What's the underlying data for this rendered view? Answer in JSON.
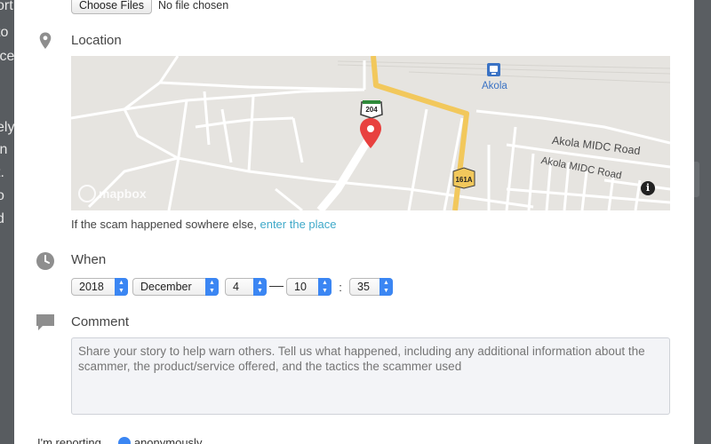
{
  "background": {
    "left_text_fragments": [
      "ort",
      "to",
      "ice",
      "ely",
      "in",
      "t.",
      "o",
      "d"
    ]
  },
  "file_upload": {
    "button_label": "Choose Files",
    "status": "No file chosen"
  },
  "location": {
    "title": "Location",
    "icon": "map-pin-icon",
    "map": {
      "labels": {
        "station": "Akola",
        "road1": "Akola MIDC Road",
        "road2": "Akola MIDC Road",
        "highway_204": "204",
        "highway_161a": "161A"
      },
      "attribution": "mapbox",
      "info_symbol": "i"
    },
    "hint_text": "If the scam happened sowhere else,",
    "hint_link": "enter the place"
  },
  "when": {
    "title": "When",
    "icon": "clock-icon",
    "year": "2018",
    "month": "December",
    "day": "4",
    "hour": "10",
    "minute": "35",
    "time_separator": ":"
  },
  "comment": {
    "title": "Comment",
    "icon": "speech-bubble-icon",
    "placeholder": "Share your story to help warn others. Tell us what happened, including any additional information about the scammer, the product/service offered, and the tactics the scammer used"
  },
  "reporting": {
    "label": "I'm reporting",
    "option": "anonymously"
  },
  "colors": {
    "accent": "#3b86f3",
    "link": "#3fa9c9",
    "pin": "#e8413f",
    "highway": "#f2c85c"
  }
}
